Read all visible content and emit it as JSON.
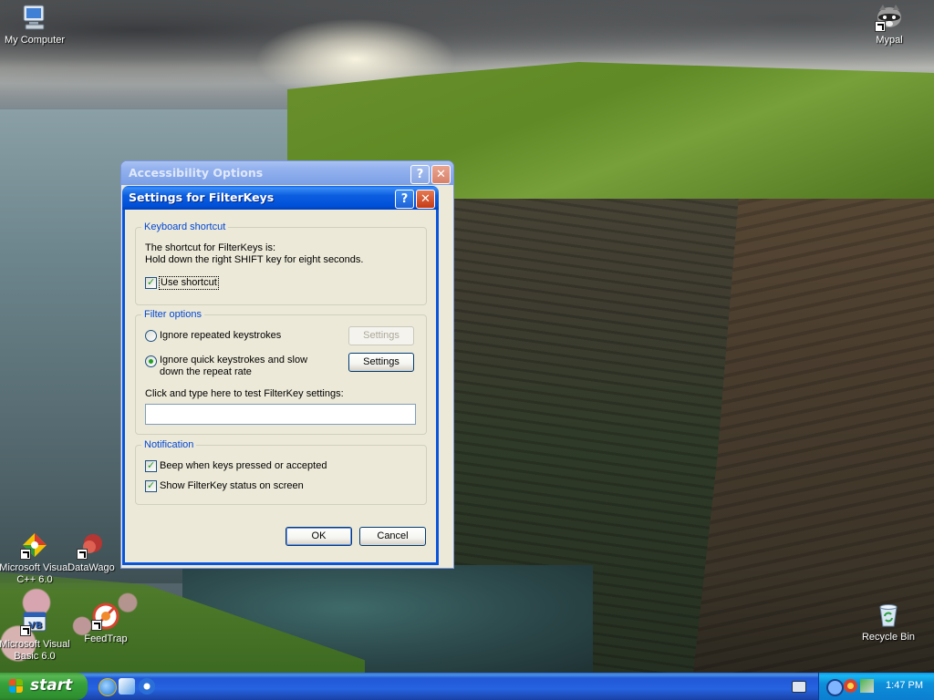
{
  "desktop": {
    "icons": [
      {
        "label": "My Computer",
        "icon": "my-computer-icon"
      },
      {
        "label": "Mypal",
        "icon": "mypal-raccoon-icon"
      },
      {
        "label": "Microsoft Visual C++ 6.0",
        "icon": "visual-cpp-icon"
      },
      {
        "label": "DataWago",
        "icon": "datawago-icon"
      },
      {
        "label": "Microsoft Visual Basic 6.0",
        "icon": "visual-basic-icon"
      },
      {
        "label": "FeedTrap",
        "icon": "feedtrap-icon"
      },
      {
        "label": "Recycle Bin",
        "icon": "recycle-bin-icon"
      }
    ]
  },
  "back_window": {
    "title": "Accessibility Options",
    "help_label": "?",
    "close_label": "✕"
  },
  "dialog": {
    "title": "Settings for FilterKeys",
    "help_label": "?",
    "close_label": "✕",
    "keyboard_shortcut": {
      "legend": "Keyboard shortcut",
      "line1": "The shortcut for FilterKeys is:",
      "line2": "Hold down the right SHIFT key for eight seconds.",
      "use_shortcut_label": "Use shortcut",
      "use_shortcut_checked": true
    },
    "filter_options": {
      "legend": "Filter options",
      "option1_label": "Ignore repeated keystrokes",
      "option1_selected": false,
      "option1_settings": "Settings",
      "option2_label_line1": "Ignore quick keystrokes and slow",
      "option2_label_line2": "down the repeat rate",
      "option2_selected": true,
      "option2_settings": "Settings",
      "test_label": "Click and type here to test FilterKey settings:",
      "test_value": ""
    },
    "notification": {
      "legend": "Notification",
      "beep_label": "Beep when keys pressed or accepted",
      "beep_checked": true,
      "status_label": "Show FilterKey status on screen",
      "status_checked": true
    },
    "ok_label": "OK",
    "cancel_label": "Cancel"
  },
  "taskbar": {
    "start_label": "start",
    "quick_launch": [
      "internet-explorer-icon",
      "media-player-icon",
      "show-desktop-icon"
    ],
    "tray_icons": [
      "keyboard-icon",
      "network-icon",
      "antivirus-icon",
      "safely-remove-icon"
    ],
    "clock": "1:47 PM"
  },
  "colors": {
    "title_active": "#0054e3",
    "title_inactive": "#7b9fe6",
    "dialog_bg": "#ece9d8",
    "legend_text": "#0046d5",
    "start_green": "#37a13a",
    "taskbar_blue": "#2457d6",
    "tray_blue": "#0c8de9"
  }
}
